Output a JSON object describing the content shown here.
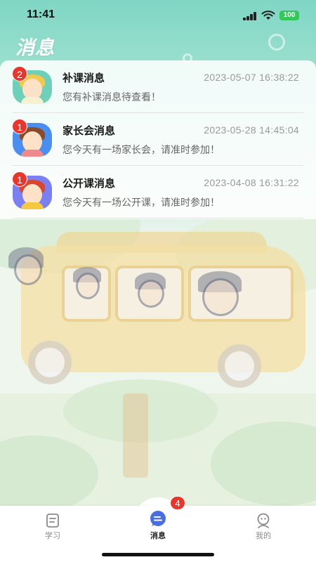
{
  "status_bar": {
    "time": "11:41",
    "battery": "100",
    "battery_color": "#34c759"
  },
  "header": {
    "title": "消息"
  },
  "messages": [
    {
      "title": "补课消息",
      "time": "2023-05-07 16:38:22",
      "preview": "您有补课消息待查看！",
      "badge": "2",
      "avatar": "girl-blonde-avatar",
      "avatar_bg": "#6fd0b9"
    },
    {
      "title": "家长会消息",
      "time": "2023-05-28 14:45:04",
      "preview": "您今天有一场家长会，请准时参加！",
      "badge": "1",
      "avatar": "girl-brown-hair-avatar",
      "avatar_bg": "#4a8ff0"
    },
    {
      "title": "公开课消息",
      "time": "2023-04-08 16:31:22",
      "preview": "您今天有一场公开课，请准时参加！",
      "badge": "1",
      "avatar": "girl-red-hair-avatar",
      "avatar_bg": "#7a7ff2"
    }
  ],
  "tab_bar": {
    "tabs": [
      {
        "label": "学习",
        "icon": "notebook-icon"
      },
      {
        "label": "消息",
        "icon": "chat-bubble-icon",
        "active": true,
        "badge": "4"
      },
      {
        "label": "我的",
        "icon": "profile-icon"
      }
    ]
  },
  "colors": {
    "badge": "#e8362d",
    "accent_blue": "#4a6ee0",
    "header_teal": "#7fd6c4"
  }
}
